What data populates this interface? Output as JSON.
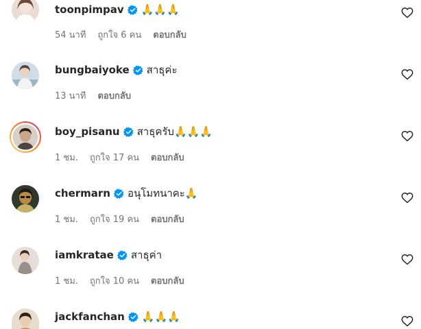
{
  "comments": [
    {
      "username": "toonpimpav",
      "text": "🙏🙏🙏",
      "time": "54 นาที",
      "likes": "ถูกใจ 6 คน",
      "reply": "ตอบกลับ",
      "avatar_color": "#e8d7cf",
      "avatar_ring": false
    },
    {
      "username": "bungbaiyoke",
      "text": "สาธุค่ะ",
      "time": "13 นาที",
      "likes": "",
      "reply": "ตอบกลับ",
      "avatar_color": "#c9d9e4",
      "avatar_ring": false
    },
    {
      "username": "boy_pisanu",
      "text": "สาธุครับ🙏🙏🙏",
      "time": "1 ชม.",
      "likes": "ถูกใจ 17 คน",
      "reply": "ตอบกลับ",
      "avatar_color": "#b8a89a",
      "avatar_ring": true
    },
    {
      "username": "chermarn",
      "text": "อนุโมทนาคะ🙏",
      "time": "1 ชม.",
      "likes": "ถูกใจ 19 คน",
      "reply": "ตอบกลับ",
      "avatar_color": "#3c3a2e",
      "avatar_ring": false
    },
    {
      "username": "iamkratae",
      "text": "สาธุค่า",
      "time": "1 ชม.",
      "likes": "ถูกใจ 10 คน",
      "reply": "ตอบกลับ",
      "avatar_color": "#d8d2cc",
      "avatar_ring": false
    },
    {
      "username": "jackfanchan",
      "text": "🙏🙏🙏",
      "time": "",
      "likes": "",
      "reply": "",
      "avatar_color": "#cdb79b",
      "avatar_ring": false
    }
  ],
  "colors": {
    "verified": "#0095f6",
    "secondary_text": "#737373",
    "primary_text": "#262626",
    "story_ring_start": "#feda75",
    "story_ring_end": "#d62976"
  },
  "icons": {
    "verified": "verified-badge-icon",
    "like": "heart-outline-icon"
  }
}
